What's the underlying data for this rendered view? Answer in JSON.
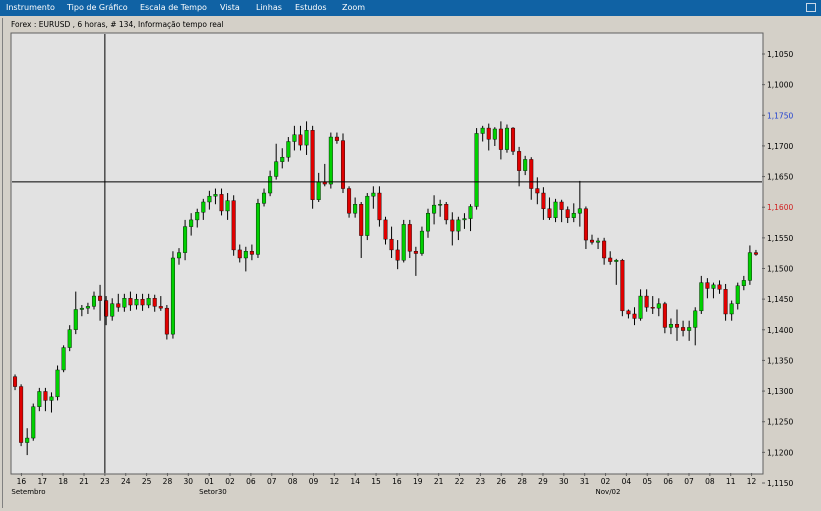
{
  "menu": {
    "items": [
      "Instrumento",
      "Tipo de Gráfico",
      "Escala de Tempo",
      "Vista",
      "Linhas",
      "Estudos",
      "Zoom"
    ]
  },
  "chart_data": {
    "type": "candlestick",
    "title": "Forex : EURUSD , 6 horas, # 134, Informação tempo real",
    "y_axis_ticks": [
      "1,1050",
      "1,1000",
      "1,1750",
      "1,1700",
      "1,1650",
      "1,1600",
      "1,1550",
      "1,1500",
      "1,1450",
      "1,1400",
      "1,1350",
      "1,1300",
      "1,1250",
      "1,1200",
      "1,1150"
    ],
    "y_axis_highlighted": [
      {
        "label": "1,1750",
        "color": "#1f3fd0"
      },
      {
        "label": "1,1600",
        "color": "#d02020"
      }
    ],
    "x_axis_ticks": [
      "16",
      "17",
      "18",
      "21",
      "23",
      "24",
      "25",
      "28",
      "30",
      "01",
      "02",
      "06",
      "07",
      "08",
      "09",
      "12",
      "14",
      "15",
      "16",
      "19",
      "21",
      "22",
      "23",
      "26",
      "28",
      "29",
      "30",
      "31",
      "02",
      "04",
      "05",
      "06",
      "07",
      "08",
      "11",
      "12"
    ],
    "x_axis_months": [
      "Setembro",
      "Setor30",
      "Nov/02"
    ],
    "ylim": [
      1.11,
      1.208
    ],
    "crosshair": {
      "price": 1.175,
      "time": "23"
    },
    "colors": {
      "up": "#00d000",
      "down": "#e00000",
      "wick": "#000000",
      "background": "#e2e2e2",
      "crosshair": "#000000"
    },
    "candles": [
      {
        "o": 1.1315,
        "h": 1.132,
        "l": 1.1285,
        "c": 1.1293
      },
      {
        "o": 1.1293,
        "h": 1.1298,
        "l": 1.116,
        "c": 1.1168
      },
      {
        "o": 1.1168,
        "h": 1.12,
        "l": 1.114,
        "c": 1.1178
      },
      {
        "o": 1.1178,
        "h": 1.1255,
        "l": 1.1172,
        "c": 1.1248
      },
      {
        "o": 1.1248,
        "h": 1.129,
        "l": 1.1238,
        "c": 1.1282
      },
      {
        "o": 1.1282,
        "h": 1.129,
        "l": 1.1238,
        "c": 1.1262
      },
      {
        "o": 1.1262,
        "h": 1.128,
        "l": 1.1235,
        "c": 1.127
      },
      {
        "o": 1.127,
        "h": 1.134,
        "l": 1.1262,
        "c": 1.133
      },
      {
        "o": 1.133,
        "h": 1.1385,
        "l": 1.1325,
        "c": 1.138
      },
      {
        "o": 1.138,
        "h": 1.143,
        "l": 1.1372,
        "c": 1.142
      },
      {
        "o": 1.142,
        "h": 1.1505,
        "l": 1.141,
        "c": 1.1465
      },
      {
        "o": 1.1465,
        "h": 1.1475,
        "l": 1.145,
        "c": 1.1468
      },
      {
        "o": 1.1468,
        "h": 1.148,
        "l": 1.1455,
        "c": 1.1472
      },
      {
        "o": 1.1472,
        "h": 1.1505,
        "l": 1.1465,
        "c": 1.1495
      },
      {
        "o": 1.1495,
        "h": 1.152,
        "l": 1.144,
        "c": 1.1485
      },
      {
        "o": 1.1485,
        "h": 1.1495,
        "l": 1.143,
        "c": 1.145
      },
      {
        "o": 1.145,
        "h": 1.149,
        "l": 1.144,
        "c": 1.1478
      },
      {
        "o": 1.1478,
        "h": 1.15,
        "l": 1.146,
        "c": 1.147
      },
      {
        "o": 1.147,
        "h": 1.15,
        "l": 1.146,
        "c": 1.149
      },
      {
        "o": 1.149,
        "h": 1.1505,
        "l": 1.1462,
        "c": 1.1475
      },
      {
        "o": 1.1475,
        "h": 1.15,
        "l": 1.1465,
        "c": 1.1488
      },
      {
        "o": 1.1488,
        "h": 1.15,
        "l": 1.1462,
        "c": 1.1475
      },
      {
        "o": 1.1475,
        "h": 1.15,
        "l": 1.1468,
        "c": 1.149
      },
      {
        "o": 1.149,
        "h": 1.1498,
        "l": 1.146,
        "c": 1.1472
      },
      {
        "o": 1.1472,
        "h": 1.1495,
        "l": 1.1462,
        "c": 1.1468
      },
      {
        "o": 1.1468,
        "h": 1.1475,
        "l": 1.1398,
        "c": 1.141
      },
      {
        "o": 1.141,
        "h": 1.1595,
        "l": 1.14,
        "c": 1.158
      },
      {
        "o": 1.158,
        "h": 1.1602,
        "l": 1.1565,
        "c": 1.1592
      },
      {
        "o": 1.1592,
        "h": 1.1665,
        "l": 1.1575,
        "c": 1.165
      },
      {
        "o": 1.165,
        "h": 1.168,
        "l": 1.163,
        "c": 1.1665
      },
      {
        "o": 1.1665,
        "h": 1.169,
        "l": 1.1648,
        "c": 1.1682
      },
      {
        "o": 1.1682,
        "h": 1.1712,
        "l": 1.1665,
        "c": 1.1705
      },
      {
        "o": 1.1705,
        "h": 1.173,
        "l": 1.1688,
        "c": 1.1718
      },
      {
        "o": 1.1718,
        "h": 1.1735,
        "l": 1.17,
        "c": 1.1722
      },
      {
        "o": 1.1722,
        "h": 1.1735,
        "l": 1.1675,
        "c": 1.1685
      },
      {
        "o": 1.1685,
        "h": 1.1725,
        "l": 1.1665,
        "c": 1.1708
      },
      {
        "o": 1.1708,
        "h": 1.172,
        "l": 1.1585,
        "c": 1.1598
      },
      {
        "o": 1.1598,
        "h": 1.161,
        "l": 1.157,
        "c": 1.158
      },
      {
        "o": 1.158,
        "h": 1.1605,
        "l": 1.155,
        "c": 1.1595
      },
      {
        "o": 1.1595,
        "h": 1.161,
        "l": 1.1575,
        "c": 1.1588
      },
      {
        "o": 1.1588,
        "h": 1.1712,
        "l": 1.158,
        "c": 1.1702
      },
      {
        "o": 1.1702,
        "h": 1.1735,
        "l": 1.1695,
        "c": 1.1725
      },
      {
        "o": 1.1725,
        "h": 1.1775,
        "l": 1.1718,
        "c": 1.1762
      },
      {
        "o": 1.1762,
        "h": 1.1835,
        "l": 1.1755,
        "c": 1.1795
      },
      {
        "o": 1.1795,
        "h": 1.1825,
        "l": 1.178,
        "c": 1.1805
      },
      {
        "o": 1.1805,
        "h": 1.185,
        "l": 1.1795,
        "c": 1.184
      },
      {
        "o": 1.184,
        "h": 1.1875,
        "l": 1.182,
        "c": 1.1855
      },
      {
        "o": 1.1855,
        "h": 1.1875,
        "l": 1.182,
        "c": 1.1832
      },
      {
        "o": 1.1832,
        "h": 1.1885,
        "l": 1.181,
        "c": 1.1865
      },
      {
        "o": 1.1865,
        "h": 1.1875,
        "l": 1.169,
        "c": 1.171
      },
      {
        "o": 1.171,
        "h": 1.177,
        "l": 1.1705,
        "c": 1.175
      },
      {
        "o": 1.175,
        "h": 1.179,
        "l": 1.174,
        "c": 1.1745
      },
      {
        "o": 1.1745,
        "h": 1.186,
        "l": 1.1735,
        "c": 1.185
      },
      {
        "o": 1.185,
        "h": 1.186,
        "l": 1.1835,
        "c": 1.1842
      },
      {
        "o": 1.1842,
        "h": 1.1858,
        "l": 1.1725,
        "c": 1.1735
      },
      {
        "o": 1.1735,
        "h": 1.174,
        "l": 1.167,
        "c": 1.168
      },
      {
        "o": 1.168,
        "h": 1.1715,
        "l": 1.167,
        "c": 1.17
      },
      {
        "o": 1.17,
        "h": 1.1705,
        "l": 1.158,
        "c": 1.163
      },
      {
        "o": 1.163,
        "h": 1.1725,
        "l": 1.162,
        "c": 1.1718
      },
      {
        "o": 1.1718,
        "h": 1.174,
        "l": 1.169,
        "c": 1.1725
      },
      {
        "o": 1.1725,
        "h": 1.174,
        "l": 1.165,
        "c": 1.1665
      },
      {
        "o": 1.1665,
        "h": 1.1672,
        "l": 1.161,
        "c": 1.1622
      },
      {
        "o": 1.1622,
        "h": 1.165,
        "l": 1.158,
        "c": 1.1598
      },
      {
        "o": 1.1598,
        "h": 1.162,
        "l": 1.1555,
        "c": 1.1575
      },
      {
        "o": 1.1575,
        "h": 1.1665,
        "l": 1.157,
        "c": 1.1655
      },
      {
        "o": 1.1655,
        "h": 1.1665,
        "l": 1.158,
        "c": 1.1595
      },
      {
        "o": 1.1595,
        "h": 1.1605,
        "l": 1.154,
        "c": 1.159
      },
      {
        "o": 1.159,
        "h": 1.165,
        "l": 1.1585,
        "c": 1.164
      },
      {
        "o": 1.164,
        "h": 1.169,
        "l": 1.1625,
        "c": 1.168
      },
      {
        "o": 1.168,
        "h": 1.172,
        "l": 1.1655,
        "c": 1.1698
      },
      {
        "o": 1.1698,
        "h": 1.171,
        "l": 1.1672,
        "c": 1.17
      },
      {
        "o": 1.17,
        "h": 1.1705,
        "l": 1.1655,
        "c": 1.1665
      },
      {
        "o": 1.1665,
        "h": 1.1682,
        "l": 1.1608,
        "c": 1.164
      },
      {
        "o": 1.164,
        "h": 1.1672,
        "l": 1.162,
        "c": 1.1665
      },
      {
        "o": 1.1665,
        "h": 1.168,
        "l": 1.1645,
        "c": 1.1668
      },
      {
        "o": 1.1668,
        "h": 1.17,
        "l": 1.164,
        "c": 1.1695
      },
      {
        "o": 1.1695,
        "h": 1.187,
        "l": 1.1688,
        "c": 1.1858
      },
      {
        "o": 1.1858,
        "h": 1.1875,
        "l": 1.184,
        "c": 1.187
      },
      {
        "o": 1.187,
        "h": 1.188,
        "l": 1.182,
        "c": 1.1845
      },
      {
        "o": 1.1845,
        "h": 1.1872,
        "l": 1.183,
        "c": 1.1868
      },
      {
        "o": 1.1868,
        "h": 1.1885,
        "l": 1.18,
        "c": 1.1822
      },
      {
        "o": 1.1822,
        "h": 1.1878,
        "l": 1.1815,
        "c": 1.187
      },
      {
        "o": 1.187,
        "h": 1.1872,
        "l": 1.181,
        "c": 1.1818
      },
      {
        "o": 1.1818,
        "h": 1.1828,
        "l": 1.174,
        "c": 1.1775
      },
      {
        "o": 1.1775,
        "h": 1.1808,
        "l": 1.1765,
        "c": 1.18
      },
      {
        "o": 1.18,
        "h": 1.1805,
        "l": 1.171,
        "c": 1.1735
      },
      {
        "o": 1.1735,
        "h": 1.176,
        "l": 1.17,
        "c": 1.1725
      },
      {
        "o": 1.1725,
        "h": 1.1738,
        "l": 1.1665,
        "c": 1.169
      },
      {
        "o": 1.169,
        "h": 1.1715,
        "l": 1.1665,
        "c": 1.167
      },
      {
        "o": 1.167,
        "h": 1.1712,
        "l": 1.166,
        "c": 1.1705
      },
      {
        "o": 1.1705,
        "h": 1.171,
        "l": 1.166,
        "c": 1.1688
      },
      {
        "o": 1.1688,
        "h": 1.1695,
        "l": 1.1658,
        "c": 1.167
      },
      {
        "o": 1.167,
        "h": 1.1702,
        "l": 1.166,
        "c": 1.168
      },
      {
        "o": 1.168,
        "h": 1.1752,
        "l": 1.165,
        "c": 1.169
      },
      {
        "o": 1.169,
        "h": 1.1695,
        "l": 1.16,
        "c": 1.162
      },
      {
        "o": 1.162,
        "h": 1.1632,
        "l": 1.161,
        "c": 1.1615
      },
      {
        "o": 1.1615,
        "h": 1.1625,
        "l": 1.16,
        "c": 1.1618
      },
      {
        "o": 1.1618,
        "h": 1.1625,
        "l": 1.1565,
        "c": 1.158
      },
      {
        "o": 1.158,
        "h": 1.1595,
        "l": 1.1565,
        "c": 1.1572
      },
      {
        "o": 1.1572,
        "h": 1.1578,
        "l": 1.152,
        "c": 1.1575
      },
      {
        "o": 1.1575,
        "h": 1.1578,
        "l": 1.145,
        "c": 1.1462
      },
      {
        "o": 1.1462,
        "h": 1.1465,
        "l": 1.1445,
        "c": 1.1455
      },
      {
        "o": 1.1455,
        "h": 1.147,
        "l": 1.143,
        "c": 1.1445
      },
      {
        "o": 1.1445,
        "h": 1.151,
        "l": 1.144,
        "c": 1.1495
      },
      {
        "o": 1.1495,
        "h": 1.151,
        "l": 1.146,
        "c": 1.147
      },
      {
        "o": 1.147,
        "h": 1.1495,
        "l": 1.1455,
        "c": 1.1468
      },
      {
        "o": 1.1468,
        "h": 1.149,
        "l": 1.145,
        "c": 1.1478
      },
      {
        "o": 1.1478,
        "h": 1.1482,
        "l": 1.1412,
        "c": 1.1425
      },
      {
        "o": 1.1425,
        "h": 1.1445,
        "l": 1.141,
        "c": 1.1432
      },
      {
        "o": 1.1432,
        "h": 1.1465,
        "l": 1.1395,
        "c": 1.1425
      },
      {
        "o": 1.1425,
        "h": 1.144,
        "l": 1.1405,
        "c": 1.1418
      },
      {
        "o": 1.1418,
        "h": 1.144,
        "l": 1.1395,
        "c": 1.1425
      },
      {
        "o": 1.1425,
        "h": 1.147,
        "l": 1.1385,
        "c": 1.1462
      },
      {
        "o": 1.1462,
        "h": 1.154,
        "l": 1.1455,
        "c": 1.1525
      },
      {
        "o": 1.1525,
        "h": 1.1535,
        "l": 1.149,
        "c": 1.1512
      },
      {
        "o": 1.1512,
        "h": 1.1525,
        "l": 1.149,
        "c": 1.152
      },
      {
        "o": 1.152,
        "h": 1.153,
        "l": 1.15,
        "c": 1.151
      },
      {
        "o": 1.151,
        "h": 1.1522,
        "l": 1.144,
        "c": 1.1455
      },
      {
        "o": 1.1455,
        "h": 1.1485,
        "l": 1.144,
        "c": 1.1478
      },
      {
        "o": 1.1478,
        "h": 1.1525,
        "l": 1.1465,
        "c": 1.1518
      },
      {
        "o": 1.1518,
        "h": 1.154,
        "l": 1.1508,
        "c": 1.153
      },
      {
        "o": 1.153,
        "h": 1.1608,
        "l": 1.152,
        "c": 1.1592
      },
      {
        "o": 1.1592,
        "h": 1.1598,
        "l": 1.1585,
        "c": 1.1588
      }
    ]
  }
}
